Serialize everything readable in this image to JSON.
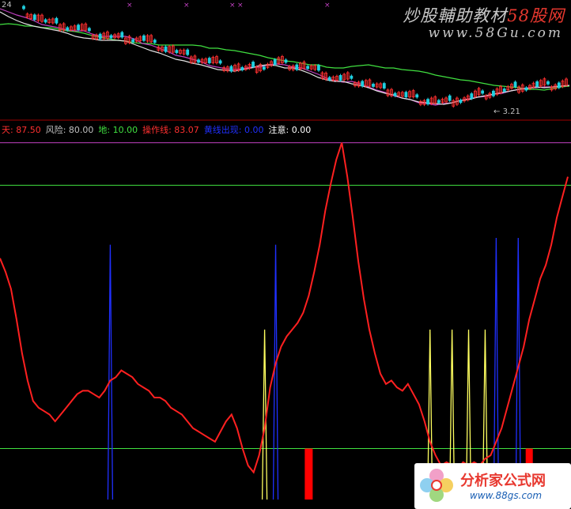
{
  "watermark": {
    "prefix": "炒股輔助教材",
    "site": "58股网",
    "url": "www.58Gu.com"
  },
  "corner_label": "24",
  "low_marker_label": "3.21",
  "legend": [
    {
      "label": "天:",
      "value": "87.50",
      "color": "#ff3030"
    },
    {
      "label": "风险:",
      "value": "80.00",
      "color": "#c0c0c0"
    },
    {
      "label": "地:",
      "value": "10.00",
      "color": "#40e040"
    },
    {
      "label": "操作线:",
      "value": "83.07",
      "color": "#ff3030"
    },
    {
      "label": "黄线出现:",
      "value": "0.00",
      "color": "#2030ff"
    },
    {
      "label": "注意:",
      "value": "0.00",
      "color": "#ffffff"
    }
  ],
  "logo": {
    "name": "分析家公式网",
    "url": "www.88gs.com"
  },
  "chart_data": [
    {
      "type": "line",
      "panel": "price",
      "series": [
        {
          "values": [
            31,
            30,
            31,
            33,
            33,
            35,
            35,
            37,
            39,
            40,
            42,
            45,
            47,
            49,
            51,
            52,
            54,
            55,
            55,
            57,
            57,
            57,
            57,
            57,
            58,
            61,
            61,
            63,
            64,
            66,
            68,
            70,
            73,
            75,
            77,
            78,
            80,
            82,
            82,
            85,
            86,
            86,
            84,
            83,
            82,
            84,
            86,
            86,
            88,
            89,
            90,
            92,
            95,
            97,
            99,
            101,
            102,
            104,
            106,
            108,
            109,
            110,
            111,
            113,
            113,
            114,
            112,
            110,
            109
          ],
          "color": "#40e040"
        },
        {
          "values": [
            11,
            15,
            19,
            22,
            26,
            31,
            33,
            35,
            38,
            39,
            39,
            43,
            46,
            46,
            46,
            46,
            49,
            55,
            57,
            61,
            65,
            70,
            72,
            75,
            78,
            83,
            85,
            87,
            88,
            87,
            85,
            85,
            82,
            81,
            82,
            85,
            86,
            90,
            94,
            99,
            102,
            104,
            103,
            106,
            110,
            114,
            117,
            121,
            124,
            126,
            130,
            131,
            133,
            131,
            130,
            127,
            125,
            123,
            122,
            119,
            118,
            115,
            113,
            111,
            111,
            110,
            110,
            109,
            108
          ],
          "color": "#c040c0"
        },
        {
          "values": [
            15,
            21,
            26,
            30,
            33,
            35,
            37,
            39,
            42,
            46,
            48,
            49,
            51,
            51,
            51,
            52,
            56,
            60,
            64,
            67,
            71,
            75,
            77,
            80,
            82,
            85,
            88,
            89,
            90,
            88,
            86,
            83,
            82,
            83,
            86,
            86,
            89,
            93,
            98,
            101,
            103,
            103,
            106,
            108,
            111,
            115,
            118,
            120,
            124,
            126,
            129,
            130,
            131,
            132,
            130,
            127,
            126,
            123,
            121,
            119,
            117,
            115,
            113,
            112,
            110,
            111,
            110,
            109,
            108
          ],
          "color": "#e0e0e0"
        }
      ]
    },
    {
      "type": "line",
      "panel": "indicator",
      "hlines": [
        {
          "y": 100,
          "color": "#c040c0"
        },
        {
          "y": 87.5,
          "color": "#40e040"
        },
        {
          "y": 10,
          "color": "#40e040"
        }
      ],
      "series": [
        {
          "values": [
            66,
            62,
            57,
            48,
            38,
            30,
            24,
            22,
            21,
            20,
            18,
            20,
            22,
            24,
            26,
            27,
            27,
            26,
            25,
            27,
            30,
            31,
            33,
            32,
            31,
            29,
            28,
            27,
            25,
            25,
            24,
            22,
            21,
            20,
            18,
            16,
            15,
            14,
            13,
            12,
            15,
            18,
            20,
            16,
            10,
            5,
            3,
            8,
            16,
            28,
            35,
            40,
            43,
            45,
            47,
            50,
            55,
            62,
            70,
            80,
            88,
            95,
            100,
            90,
            78,
            65,
            54,
            45,
            38,
            32,
            29,
            30,
            28,
            27,
            29,
            26,
            23,
            18,
            12,
            8,
            5,
            6,
            5,
            4,
            6,
            5,
            6,
            5,
            7,
            8,
            12,
            16,
            22,
            28,
            34,
            40,
            48,
            54,
            60,
            64,
            70,
            78,
            84,
            90
          ],
          "color": "#ff2020"
        }
      ],
      "spikes": [
        {
          "index": 20,
          "value": 70,
          "color": "#2030ff"
        },
        {
          "index": 48,
          "value": 45,
          "color": "#ffff60"
        },
        {
          "index": 50,
          "value": 70,
          "color": "#2030ff"
        },
        {
          "index": 78,
          "value": 45,
          "color": "#ffff60"
        },
        {
          "index": 82,
          "value": 45,
          "color": "#ffff60"
        },
        {
          "index": 85,
          "value": 45,
          "color": "#ffff60"
        },
        {
          "index": 88,
          "value": 45,
          "color": "#ffff60"
        },
        {
          "index": 90,
          "value": 72,
          "color": "#2030ff"
        },
        {
          "index": 94,
          "value": 72,
          "color": "#2030ff"
        }
      ],
      "bars": [
        {
          "index": 56,
          "value": 10,
          "color": "#ff0000"
        },
        {
          "index": 96,
          "value": 10,
          "color": "#ff0000"
        }
      ]
    }
  ]
}
